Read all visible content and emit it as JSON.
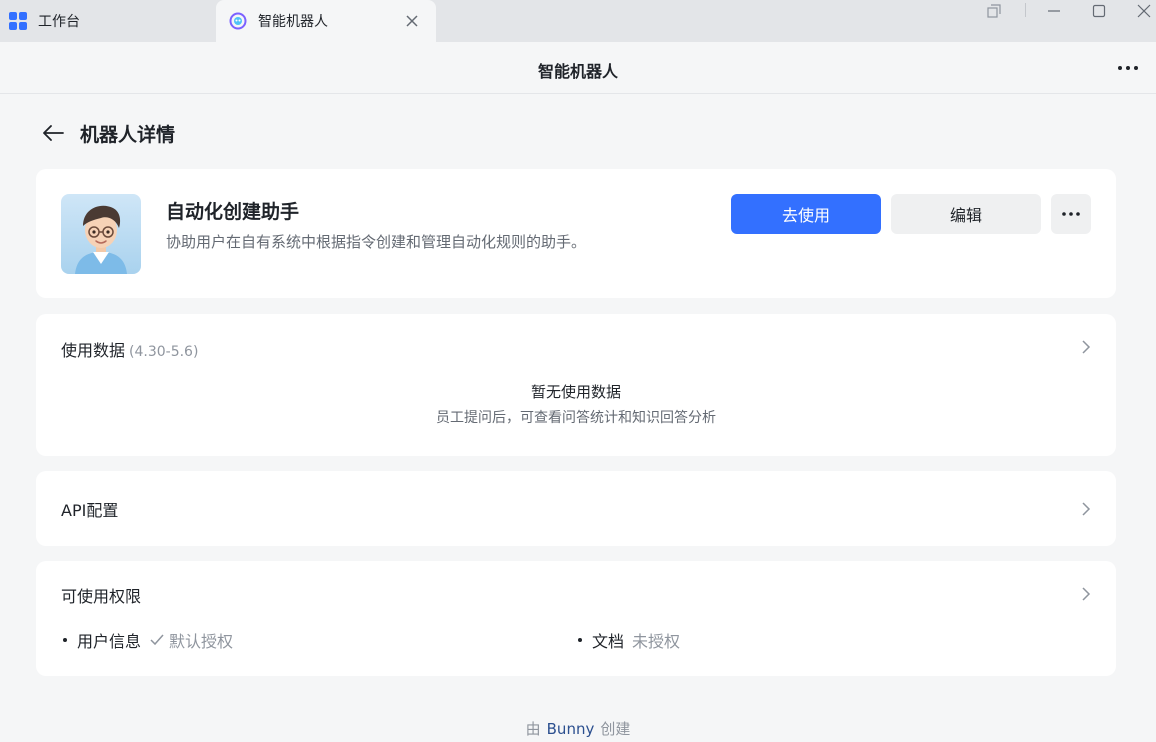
{
  "tabs": [
    {
      "label": "工作台",
      "icon": "apps-grid-icon"
    },
    {
      "label": "智能机器人",
      "icon": "robot-app-icon",
      "active": true
    }
  ],
  "header": {
    "title": "智能机器人"
  },
  "page": {
    "title": "机器人详情"
  },
  "bot": {
    "name": "自动化创建助手",
    "description": "协助用户在自有系统中根据指令创建和管理自动化规则的助手。",
    "use_button": "去使用",
    "edit_button": "编辑"
  },
  "usage": {
    "title": "使用数据",
    "range": "(4.30-5.6)",
    "empty_title": "暂无使用数据",
    "empty_desc": "员工提问后，可查看问答统计和知识回答分析"
  },
  "api": {
    "title": "API配置"
  },
  "permissions": {
    "title": "可使用权限",
    "items": [
      {
        "name": "用户信息",
        "status": "默认授权"
      },
      {
        "name": "文档",
        "status": "未授权"
      }
    ]
  },
  "footer": {
    "prefix": "由",
    "author": "Bunny",
    "suffix": "创建"
  },
  "colors": {
    "primary": "#3370ff",
    "background": "#f5f6f7",
    "card": "#ffffff"
  }
}
